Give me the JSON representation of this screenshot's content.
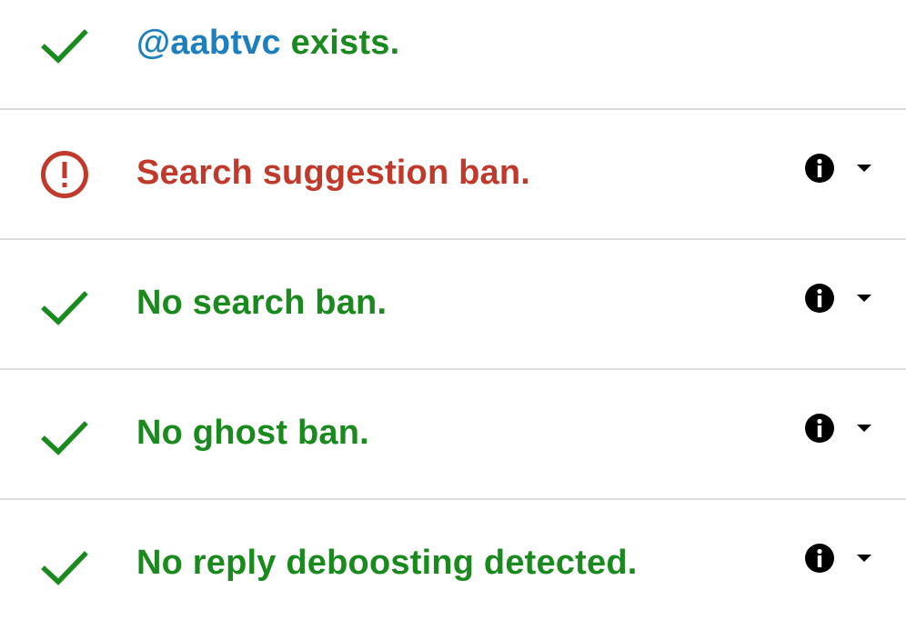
{
  "colors": {
    "success": "#1a8a1e",
    "error": "#c0392b",
    "handle": "#1e7fc0",
    "divider": "#dcdcdc"
  },
  "rows": [
    {
      "status": "success",
      "icon": "check-icon",
      "handle": "@aabtvc",
      "text": " exists.",
      "has_details": false
    },
    {
      "status": "error",
      "icon": "alert-circle-icon",
      "text": "Search suggestion ban.",
      "has_details": true,
      "detail_icons": [
        "info-icon",
        "caret-down-icon"
      ]
    },
    {
      "status": "success",
      "icon": "check-icon",
      "text": "No search ban.",
      "has_details": true,
      "detail_icons": [
        "info-icon",
        "caret-down-icon"
      ]
    },
    {
      "status": "success",
      "icon": "check-icon",
      "text": "No ghost ban.",
      "has_details": true,
      "detail_icons": [
        "info-icon",
        "caret-down-icon"
      ]
    },
    {
      "status": "success",
      "icon": "check-icon",
      "text": "No reply deboosting detected.",
      "has_details": true,
      "detail_icons": [
        "info-icon",
        "caret-down-icon"
      ]
    }
  ]
}
